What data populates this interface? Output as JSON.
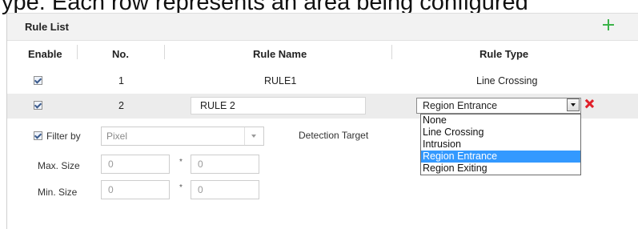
{
  "top_text": "ype. Each row represents an area being configured",
  "rule_list": {
    "title": "Rule List",
    "columns": {
      "enable": "Enable",
      "no": "No.",
      "rule_name": "Rule Name",
      "rule_type": "Rule Type"
    },
    "rows": [
      {
        "number": "1",
        "name": "RULE1",
        "type": "Line Crossing",
        "enabled": true
      },
      {
        "number": "2",
        "name": "RULE 2",
        "type": "Region Entrance",
        "enabled": true
      }
    ]
  },
  "rule_type_options": [
    "None",
    "Line Crossing",
    "Intrusion",
    "Region Entrance",
    "Region Exiting"
  ],
  "selected_rule_type": "Region Entrance",
  "filter": {
    "label": "Filter by",
    "value": "Pixel",
    "enabled": true,
    "detection_target_label": "Detection Target",
    "max_size_label": "Max. Size",
    "min_size_label": "Min. Size",
    "max_width": "0",
    "max_height": "0",
    "min_width": "0",
    "min_height": "0",
    "times": "*"
  },
  "colors": {
    "accent_add": "#3cb34a",
    "delete": "#e0202a",
    "selection": "#3399ff"
  }
}
